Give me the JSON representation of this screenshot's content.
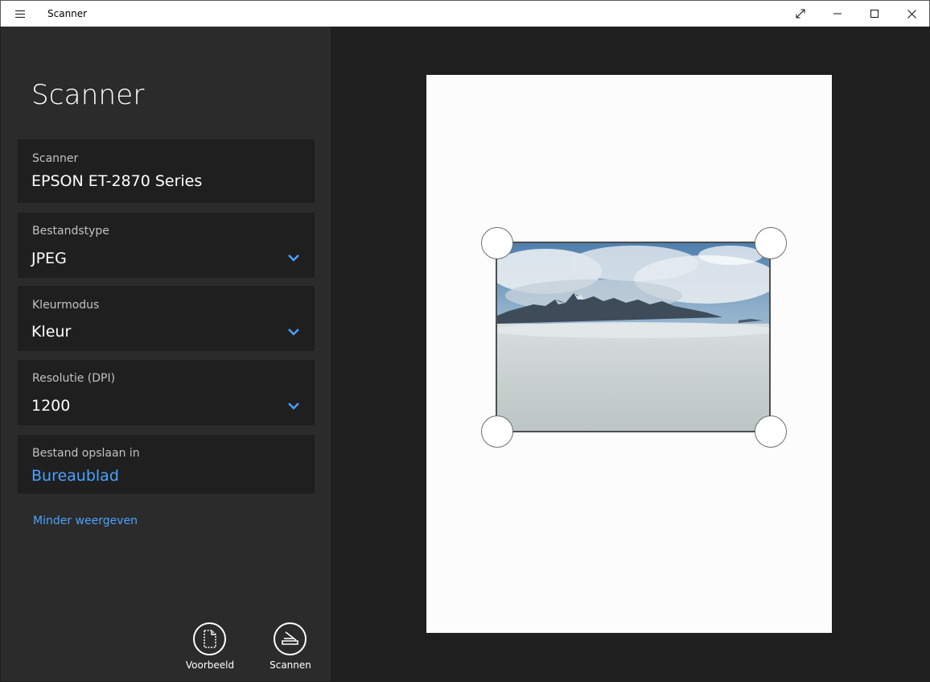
{
  "window": {
    "title": "Scanner",
    "controls": {
      "fullscreen_icon": "expand-arrows-icon",
      "minimize_icon": "minimize-icon",
      "maximize_icon": "maximize-icon",
      "close_icon": "close-icon"
    }
  },
  "sidebar": {
    "heading": "Scanner",
    "fields": [
      {
        "label": "Scanner",
        "value": "EPSON ET-2870 Series"
      },
      {
        "label": "Bestandstype",
        "value": "JPEG"
      },
      {
        "label": "Kleurmodus",
        "value": "Kleur"
      },
      {
        "label": "Resolutie (DPI)",
        "value": "1200"
      },
      {
        "label": "Bestand opslaan in",
        "value": "Bureaublad"
      }
    ],
    "toggle_link": "Minder weergeven",
    "actions": {
      "preview_label": "Voorbeeld",
      "scan_label": "Scannen"
    }
  },
  "colors": {
    "accent": "#4aa3ff",
    "sidebar_bg": "#2b2b2b",
    "card_bg": "#1f1f1f",
    "preview_bg": "#1f1f1f"
  },
  "preview": {
    "content": "scanned-photo-mountains-above-clouds"
  }
}
